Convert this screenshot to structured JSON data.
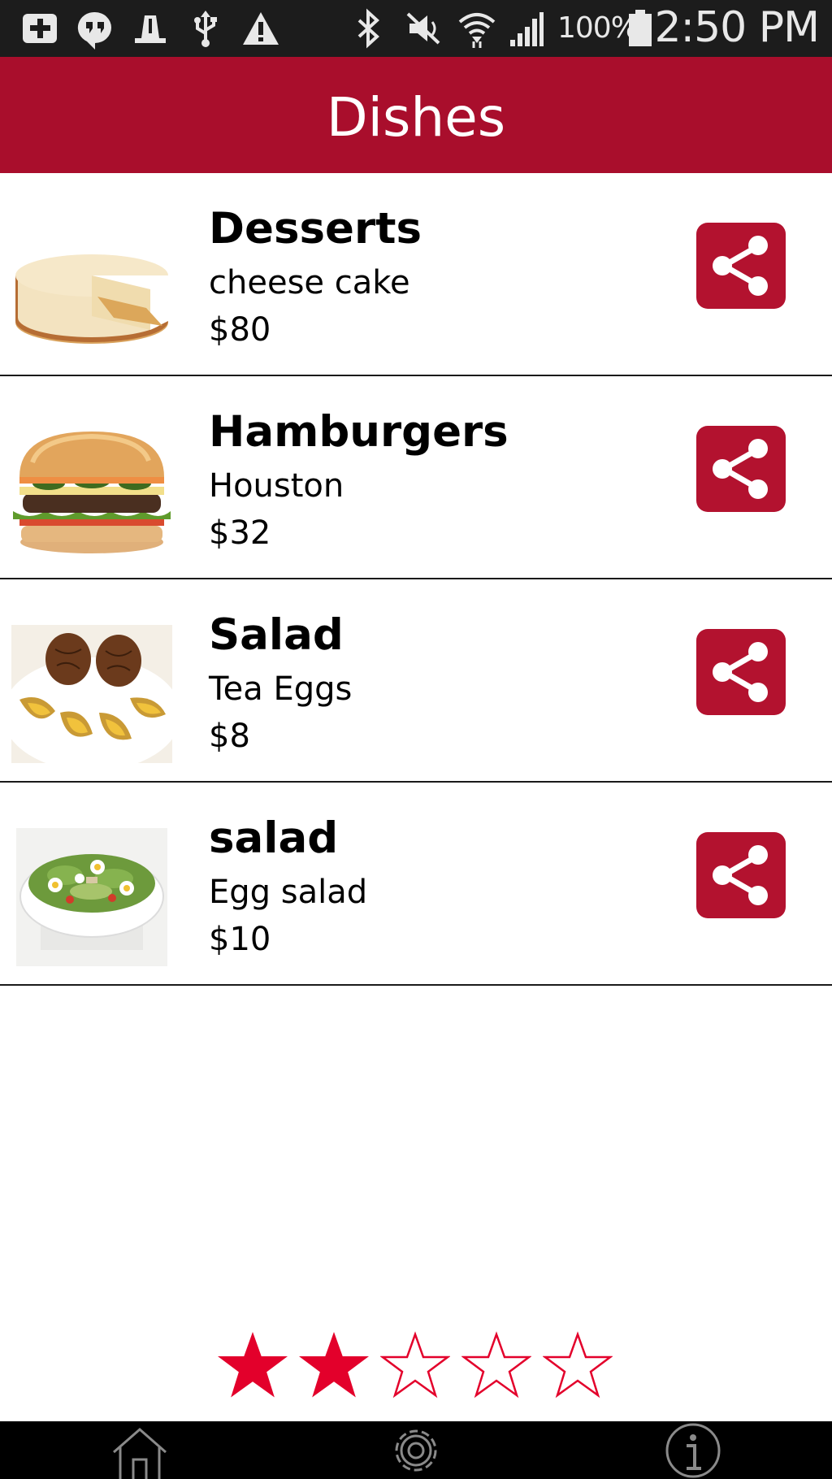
{
  "status_bar": {
    "battery_percent": "100%",
    "time": "2:50 PM",
    "icons": [
      "add-box-icon",
      "hangouts-icon",
      "notification-icon",
      "usb-icon",
      "warning-icon",
      "bluetooth-icon",
      "mute-icon",
      "wifi-icon",
      "signal-icon",
      "battery-icon"
    ]
  },
  "header": {
    "title": "Dishes"
  },
  "dishes": [
    {
      "category": "Desserts",
      "name": "cheese cake",
      "price": "$80",
      "image": "cheesecake-image"
    },
    {
      "category": "Hamburgers",
      "name": "Houston",
      "price": "$32",
      "image": "hamburger-image"
    },
    {
      "category": "Salad",
      "name": "Tea Eggs",
      "price": "$8",
      "image": "tea-eggs-image"
    },
    {
      "category": "salad",
      "name": "Egg salad",
      "price": "$10",
      "image": "egg-salad-image"
    }
  ],
  "rating": {
    "value": 2,
    "max": 5
  },
  "bottom_nav": {
    "icons": [
      "home-icon",
      "settings-icon",
      "info-icon"
    ]
  },
  "colors": {
    "accent": "#a90e2c",
    "share_button": "#b3122f",
    "star": "#e3002b",
    "status_bar": "#1c1c1c",
    "nav_bar": "#000000"
  }
}
